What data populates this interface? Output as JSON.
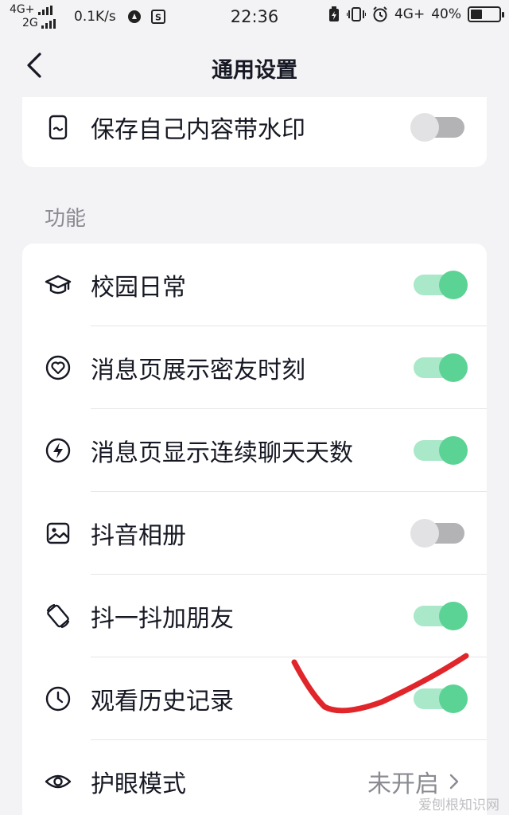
{
  "status_bar": {
    "network_top": "4G+",
    "network_bottom": "2G",
    "speed": "0.1K/s",
    "time": "22:36",
    "network_right": "4G+",
    "battery": "40%",
    "battery_level": 0.4
  },
  "nav": {
    "title": "通用设置",
    "back_icon": "chevron-left-icon"
  },
  "top_card": {
    "rows": [
      {
        "icon": "phone-watermark-icon",
        "label": "保存自己内容带水印",
        "toggle": false
      }
    ]
  },
  "section": {
    "title": "功能"
  },
  "features": {
    "rows": [
      {
        "icon": "graduation-cap-icon",
        "label": "校园日常",
        "toggle": true
      },
      {
        "icon": "heart-circle-icon",
        "label": "消息页展示密友时刻",
        "toggle": true
      },
      {
        "icon": "lightning-circle-icon",
        "label": "消息页显示连续聊天天数",
        "toggle": true
      },
      {
        "icon": "image-icon",
        "label": "抖音相册",
        "toggle": false
      },
      {
        "icon": "rotate-phone-icon",
        "label": "抖一抖加朋友",
        "toggle": true
      },
      {
        "icon": "clock-icon",
        "label": "观看历史记录",
        "toggle": true
      },
      {
        "icon": "eye-icon",
        "label": "护眼模式",
        "value": "未开启"
      }
    ]
  },
  "colors": {
    "toggle_on_track": "#a9e8c9",
    "toggle_on_knob": "#5bd394",
    "toggle_off_track": "#b3b3b5",
    "annotation": "#e0262b"
  },
  "watermark": "爱刨根知识网"
}
